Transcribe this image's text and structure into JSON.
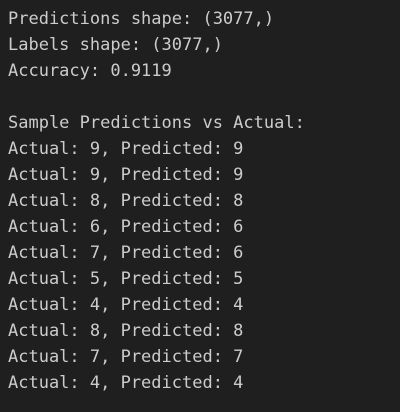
{
  "output": {
    "summary": [
      "Predictions shape: (3077,)",
      "Labels shape: (3077,)",
      "Accuracy: 0.9119"
    ],
    "samples_header": "Sample Predictions vs Actual:",
    "samples": [
      "Actual: 9, Predicted: 9",
      "Actual: 9, Predicted: 9",
      "Actual: 8, Predicted: 8",
      "Actual: 6, Predicted: 6",
      "Actual: 7, Predicted: 6",
      "Actual: 5, Predicted: 5",
      "Actual: 4, Predicted: 4",
      "Actual: 8, Predicted: 8",
      "Actual: 7, Predicted: 7",
      "Actual: 4, Predicted: 4"
    ]
  },
  "colors": {
    "background": "#1f1f1f",
    "text": "#cccccc"
  }
}
